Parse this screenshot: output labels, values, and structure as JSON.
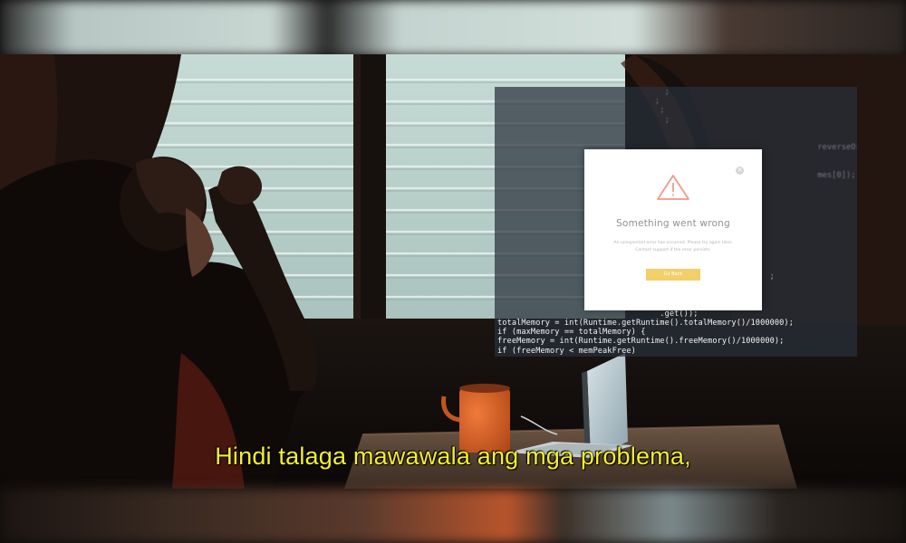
{
  "code_overlay": {
    "lines": [
      "                                   ;",
      "                                 ;",
      "                                  ;",
      "                                   ;",
      "",
      "",
      "                                                                   reverseOrder()); }",
      "",
      "",
      "                                                                   mes[0]);",
      "",
      "",
      "",
      "",
      "",
      "",
      "",
      "",
      "",
      "",
      "                                                         ;",
      "",
      "",
      "                              ()/1000000);",
      "                                  .get());",
      "totalMemory = int(Runtime.getRuntime().totalMemory()/1000000);",
      "if (maxMemory == totalMemory) {",
      "freeMemory = int(Runtime.getRuntime().freeMemory()/1000000);",
      "if (freeMemory < memPeakFree)"
    ]
  },
  "dialog": {
    "title": "Something went wrong",
    "message_line1": "An unexpected error has occurred. Please try again later.",
    "message_line2": "Contact support if the error persists.",
    "button_label": "Go Back",
    "accent_color": "#f3cf69",
    "warning_color": "#ef9a88",
    "close_icon": "close-icon",
    "warning_icon": "warning-triangle-icon"
  },
  "subtitle": {
    "text": "Hindi talaga mawawala ang mga problema,",
    "color": "#f4f02a"
  }
}
